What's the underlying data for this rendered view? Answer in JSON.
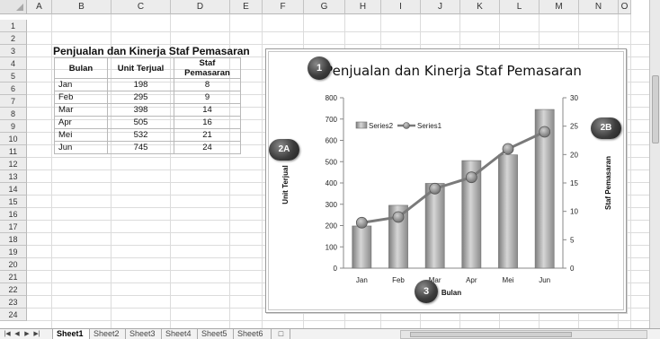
{
  "grid": {
    "columns": [
      "A",
      "B",
      "C",
      "D",
      "E",
      "F",
      "G",
      "H",
      "I",
      "J",
      "K",
      "L",
      "M",
      "N",
      "O"
    ],
    "rows": [
      "1",
      "2",
      "3",
      "4",
      "5",
      "6",
      "7",
      "8",
      "9",
      "10",
      "11",
      "12",
      "13",
      "14",
      "15",
      "16",
      "17",
      "18",
      "19",
      "20",
      "21",
      "22",
      "23",
      "24"
    ]
  },
  "table": {
    "title": "Penjualan dan Kinerja Staf Pemasaran",
    "headers": [
      "Bulan",
      "Unit Terjual",
      "Staf Pemasaran"
    ],
    "rows": [
      [
        "Jan",
        "198",
        "8"
      ],
      [
        "Feb",
        "295",
        "9"
      ],
      [
        "Mar",
        "398",
        "14"
      ],
      [
        "Apr",
        "505",
        "16"
      ],
      [
        "Mei",
        "532",
        "21"
      ],
      [
        "Jun",
        "745",
        "24"
      ]
    ]
  },
  "chart_data": {
    "type": "bar",
    "title": "Penjualan dan Kinerja Staf Pemasaran",
    "xlabel": "Bulan",
    "ylabel": "Unit Terjual",
    "y2label": "Staf Pemasaran",
    "categories": [
      "Jan",
      "Feb",
      "Mar",
      "Apr",
      "Mei",
      "Jun"
    ],
    "ylim": [
      0,
      800
    ],
    "yticks": [
      "0",
      "100",
      "200",
      "300",
      "400",
      "500",
      "600",
      "700",
      "800"
    ],
    "y2lim": [
      0,
      30
    ],
    "y2ticks": [
      "0",
      "5",
      "10",
      "15",
      "20",
      "25",
      "30"
    ],
    "legend_position": "upper-left inside plot",
    "series": [
      {
        "name": "Series2",
        "type": "bar",
        "axis": "left",
        "values": [
          198,
          295,
          398,
          505,
          532,
          745
        ]
      },
      {
        "name": "Series1",
        "type": "line",
        "axis": "right",
        "values": [
          8,
          9,
          14,
          16,
          21,
          24
        ]
      }
    ],
    "colors": {
      "bar": "#a3a3a3",
      "line": "#7a7a7a",
      "marker": "#8f8f8f"
    }
  },
  "badges": {
    "title": "1",
    "left_axis": "2A",
    "right_axis": "2B",
    "x_axis": "3"
  },
  "sheet_tabs": [
    "Sheet1",
    "Sheet2",
    "Sheet3",
    "Sheet4",
    "Sheet5",
    "Sheet6"
  ],
  "active_tab": "Sheet1"
}
